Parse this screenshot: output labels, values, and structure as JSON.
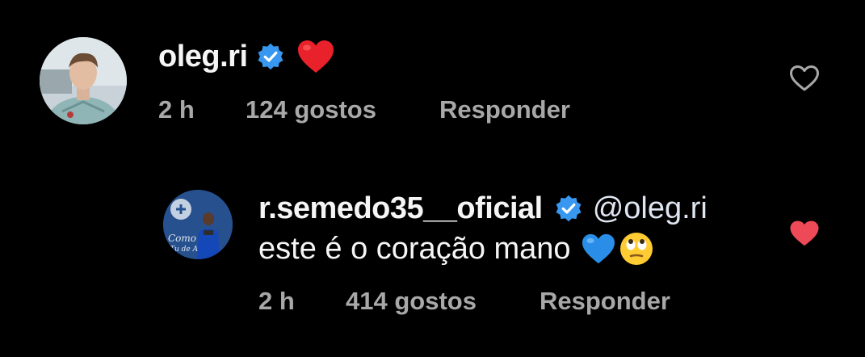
{
  "comments": [
    {
      "username": "oleg.ri",
      "verified": true,
      "reaction_emoji": "red-heart",
      "time": "2 h",
      "likes": "124 gostos",
      "reply_label": "Responder",
      "liked": false
    },
    {
      "username": "r.semedo35__oficial",
      "verified": true,
      "mention": "@oleg.ri",
      "text": "este é o coração mano",
      "emojis": [
        "blue-heart",
        "face-with-rolling-eyes"
      ],
      "time": "2 h",
      "likes": "414 gostos",
      "reply_label": "Responder",
      "liked": true
    }
  ],
  "colors": {
    "background": "#000000",
    "text": "#f5f5f5",
    "meta_text": "#a8a8a8",
    "verified_blue": "#3897f0",
    "like_red": "#ed4956",
    "outline_heart": "#a8a8a8"
  }
}
